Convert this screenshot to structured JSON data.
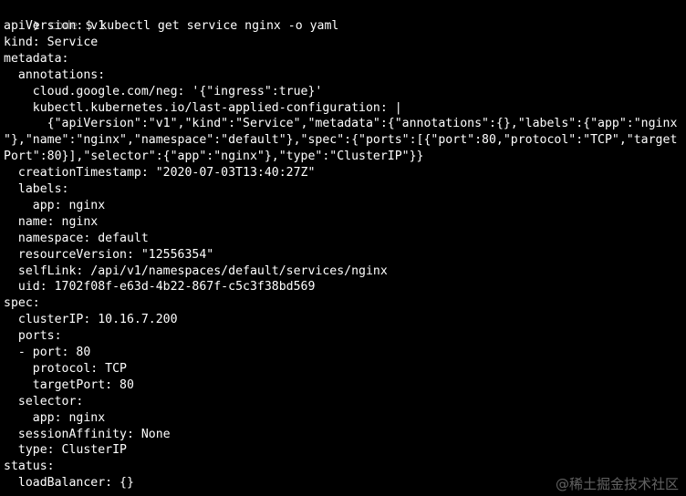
{
  "prompt": {
    "arrow": "❯",
    "dir": "code",
    "symbol": "$",
    "command": "kubectl get service nginx -o yaml"
  },
  "output_lines": [
    "apiVersion: v1",
    "kind: Service",
    "metadata:",
    "  annotations:",
    "    cloud.google.com/neg: '{\"ingress\":true}'",
    "    kubectl.kubernetes.io/last-applied-configuration: |",
    "      {\"apiVersion\":\"v1\",\"kind\":\"Service\",\"metadata\":{\"annotations\":{},\"labels\":{\"app\":\"nginx",
    "\"},\"name\":\"nginx\",\"namespace\":\"default\"},\"spec\":{\"ports\":[{\"port\":80,\"protocol\":\"TCP\",\"target",
    "Port\":80}],\"selector\":{\"app\":\"nginx\"},\"type\":\"ClusterIP\"}}",
    "  creationTimestamp: \"2020-07-03T13:40:27Z\"",
    "  labels:",
    "    app: nginx",
    "  name: nginx",
    "  namespace: default",
    "  resourceVersion: \"12556354\"",
    "  selfLink: /api/v1/namespaces/default/services/nginx",
    "  uid: 1702f08f-e63d-4b22-867f-c5c3f38bd569",
    "spec:",
    "  clusterIP: 10.16.7.200",
    "  ports:",
    "  - port: 80",
    "    protocol: TCP",
    "    targetPort: 80",
    "  selector:",
    "    app: nginx",
    "  sessionAffinity: None",
    "  type: ClusterIP",
    "status:",
    "  loadBalancer: {}"
  ],
  "watermark": "@稀土掘金技术社区",
  "colors": {
    "background": "#000000",
    "text": "#ffffff",
    "prompt_dir": "#6e6e6e"
  }
}
